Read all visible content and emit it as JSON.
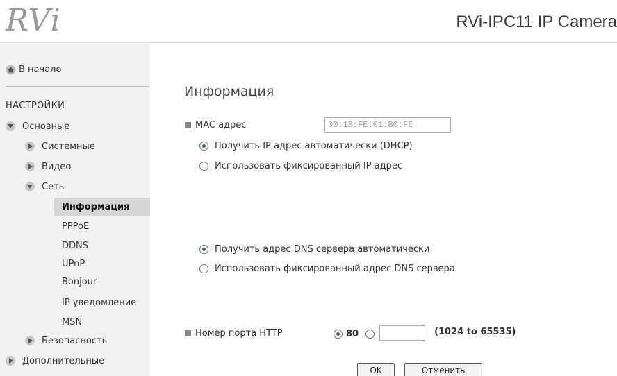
{
  "header": {
    "logo": "RVi",
    "product_title": "RVi-IPC11 IP Camera"
  },
  "sidebar": {
    "home_label": "В начало",
    "section_title": "НАСТРОЙКИ",
    "basic_label": "Основные",
    "system_label": "Системные",
    "video_label": "Видео",
    "network_label": "Сеть",
    "network_sub": [
      "Информация",
      "PPPoE",
      "DDNS",
      "UPnP",
      "Bonjour",
      "IP уведомление",
      "MSN"
    ],
    "security_label": "Безопасность",
    "advanced_label": "Дополнительные"
  },
  "main": {
    "title": "Информация",
    "mac_label": "MAC адрес",
    "mac_value": "00:1B:FE:01:B0:FE",
    "ip_options": [
      "Получить IP адрес автоматически (DHCP)",
      "Использовать фиксированный IP адрес"
    ],
    "ip_selected": 0,
    "dns_options": [
      "Получить адрес DNS сервера автоматически",
      "Использовать фиксированный адрес DNS сервера"
    ],
    "dns_selected": 0,
    "http_port_label": "Номер порта HTTP",
    "http_port_default": "80",
    "http_port_custom_value": "",
    "http_port_range": "(1024 to 65535)",
    "ok_label": "OK",
    "cancel_label": "Отменить"
  },
  "colors": {
    "active_nav_bg": "#d6d6d6",
    "sidebar_bg": "#f2f2f2",
    "logo": "#9a9a9a"
  }
}
